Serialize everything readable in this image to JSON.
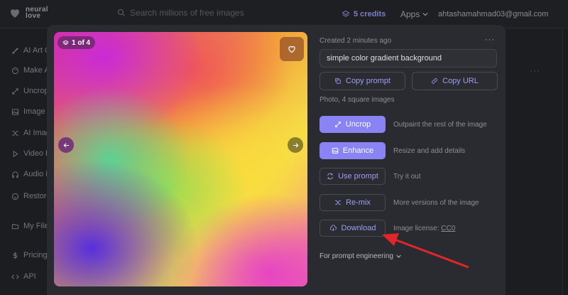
{
  "topbar": {
    "logo_text_line1": "neural",
    "logo_text_line2": "love",
    "search_placeholder": "Search millions of free images",
    "credits": "5 credits",
    "apps": "Apps",
    "email": "ahtashamahmad03@gmail.com"
  },
  "sidebar": {
    "items": [
      {
        "label": "AI Art Generator",
        "icon": "brush-icon"
      },
      {
        "label": "Make AI Art",
        "icon": "palette-icon"
      },
      {
        "label": "Uncrop",
        "icon": "expand-icon"
      },
      {
        "label": "Image Enhancer",
        "icon": "image-icon"
      },
      {
        "label": "AI Image Remix",
        "icon": "shuffle-icon"
      },
      {
        "label": "Video Enhancer",
        "icon": "play-icon"
      },
      {
        "label": "Audio Enhancer",
        "icon": "headphones-icon"
      },
      {
        "label": "Restore Faces",
        "icon": "face-icon"
      },
      {
        "label": "My Files",
        "icon": "folder-icon"
      },
      {
        "label": "Pricing",
        "icon": "dollar-icon"
      },
      {
        "label": "API",
        "icon": "code-icon"
      }
    ]
  },
  "modal": {
    "image_counter": "1 of 4",
    "created": "Created 2 minutes ago",
    "prompt": "simple color gradient background",
    "copy_prompt": "Copy prompt",
    "copy_url": "Copy URL",
    "meta": "Photo, 4 square images",
    "actions": [
      {
        "label": "Uncrop",
        "desc": "Outpaint the rest of the image"
      },
      {
        "label": "Enhance",
        "desc": "Resize and add details"
      },
      {
        "label": "Use prompt",
        "desc": "Try it out"
      },
      {
        "label": "Re-mix",
        "desc": "More versions of the image"
      },
      {
        "label": "Download",
        "desc": "Image license:",
        "license": "CC0"
      }
    ],
    "engineering": "For prompt engineering"
  },
  "colors": {
    "accent": "#8a83f3",
    "accent_text": "#9c9ef4",
    "annotation_arrow": "#e0262b",
    "background": "#1c1d21",
    "modal": "#2a2b30"
  }
}
